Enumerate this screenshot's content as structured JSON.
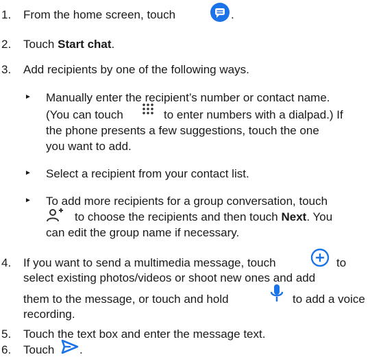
{
  "steps": [
    {
      "number": "1.",
      "text_before": "From the home screen, touch",
      "text_after": ".",
      "icon": "messages-app-icon"
    },
    {
      "number": "2.",
      "text_before": "Touch",
      "bold": "Start chat",
      "text_after": "."
    },
    {
      "number": "3.",
      "text": "Add recipients by one of the following ways.",
      "bullets": [
        {
          "lines": [
            "Manually enter the recipient’s number or contact name.",
            "(You can touch",
            "to enter numbers with a dialpad.) If",
            "the phone presents a few suggestions, touch the one",
            "you want to add."
          ],
          "icon": "dialpad-icon"
        },
        {
          "lines": [
            "Select a recipient from your contact list."
          ]
        },
        {
          "lines": [
            "To add more recipients for a group conversation, touch",
            "to choose the recipients and then touch",
            "Next",
            ". You",
            "can edit the group name if necessary."
          ],
          "icon": "add-contact-icon"
        }
      ]
    },
    {
      "number": "4.",
      "lines": [
        "If you want to send a multimedia message, touch",
        "to",
        "select existing photos/videos or shoot new ones and add",
        "them to the message, or touch and hold",
        "to add a voice",
        "recording."
      ],
      "icons": [
        "add-circle-icon",
        "microphone-icon"
      ]
    },
    {
      "number": "5.",
      "text": "Touch the text box and enter the message text."
    },
    {
      "number": "6.",
      "text": "Touch",
      "text_after": ".",
      "icon": "send-icon"
    }
  ],
  "colors": {
    "icon_blue": "#1a73e8",
    "text": "#1a1a1a"
  }
}
